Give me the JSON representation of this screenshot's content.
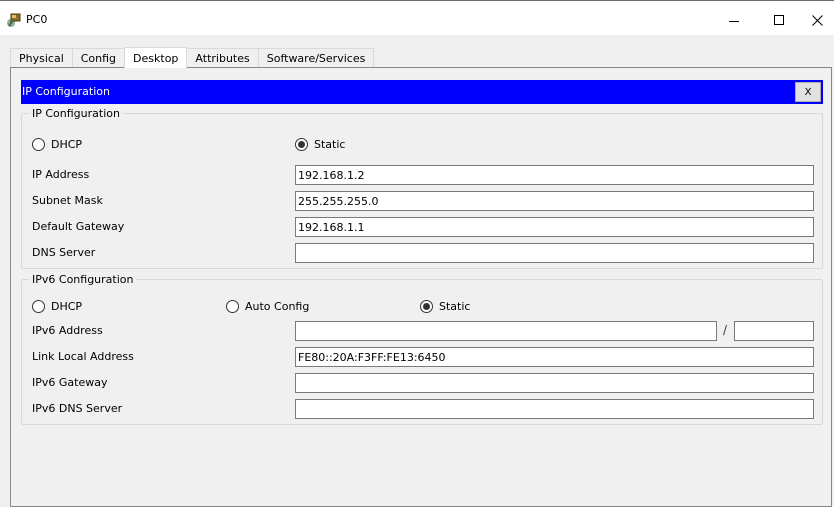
{
  "window": {
    "title": "PC0",
    "minimize_label": "minimize",
    "maximize_label": "maximize",
    "close_label": "close"
  },
  "tabs": [
    {
      "label": "Physical",
      "active": false
    },
    {
      "label": "Config",
      "active": false
    },
    {
      "label": "Desktop",
      "active": true
    },
    {
      "label": "Attributes",
      "active": false
    },
    {
      "label": "Software/Services",
      "active": false
    }
  ],
  "app": {
    "title": "IP Configuration",
    "close_label": "X",
    "header_color": "#0000ff"
  },
  "ipv4": {
    "legend": "IP Configuration",
    "mode_options": [
      {
        "label": "DHCP",
        "selected": false
      },
      {
        "label": "Static",
        "selected": true
      }
    ],
    "fields": [
      {
        "label": "IP Address",
        "value": "192.168.1.2"
      },
      {
        "label": "Subnet Mask",
        "value": "255.255.255.0"
      },
      {
        "label": "Default Gateway",
        "value": "192.168.1.1"
      },
      {
        "label": "DNS Server",
        "value": ""
      }
    ]
  },
  "ipv6": {
    "legend": "IPv6 Configuration",
    "mode_options": [
      {
        "label": "DHCP",
        "selected": false
      },
      {
        "label": "Auto Config",
        "selected": false
      },
      {
        "label": "Static",
        "selected": true
      }
    ],
    "address": {
      "label": "IPv6 Address",
      "value": "",
      "prefix_separator": "/",
      "prefix_value": ""
    },
    "fields": [
      {
        "label": "Link Local Address",
        "value": "FE80::20A:F3FF:FE13:6450"
      },
      {
        "label": "IPv6 Gateway",
        "value": ""
      },
      {
        "label": "IPv6 DNS Server",
        "value": ""
      }
    ]
  }
}
